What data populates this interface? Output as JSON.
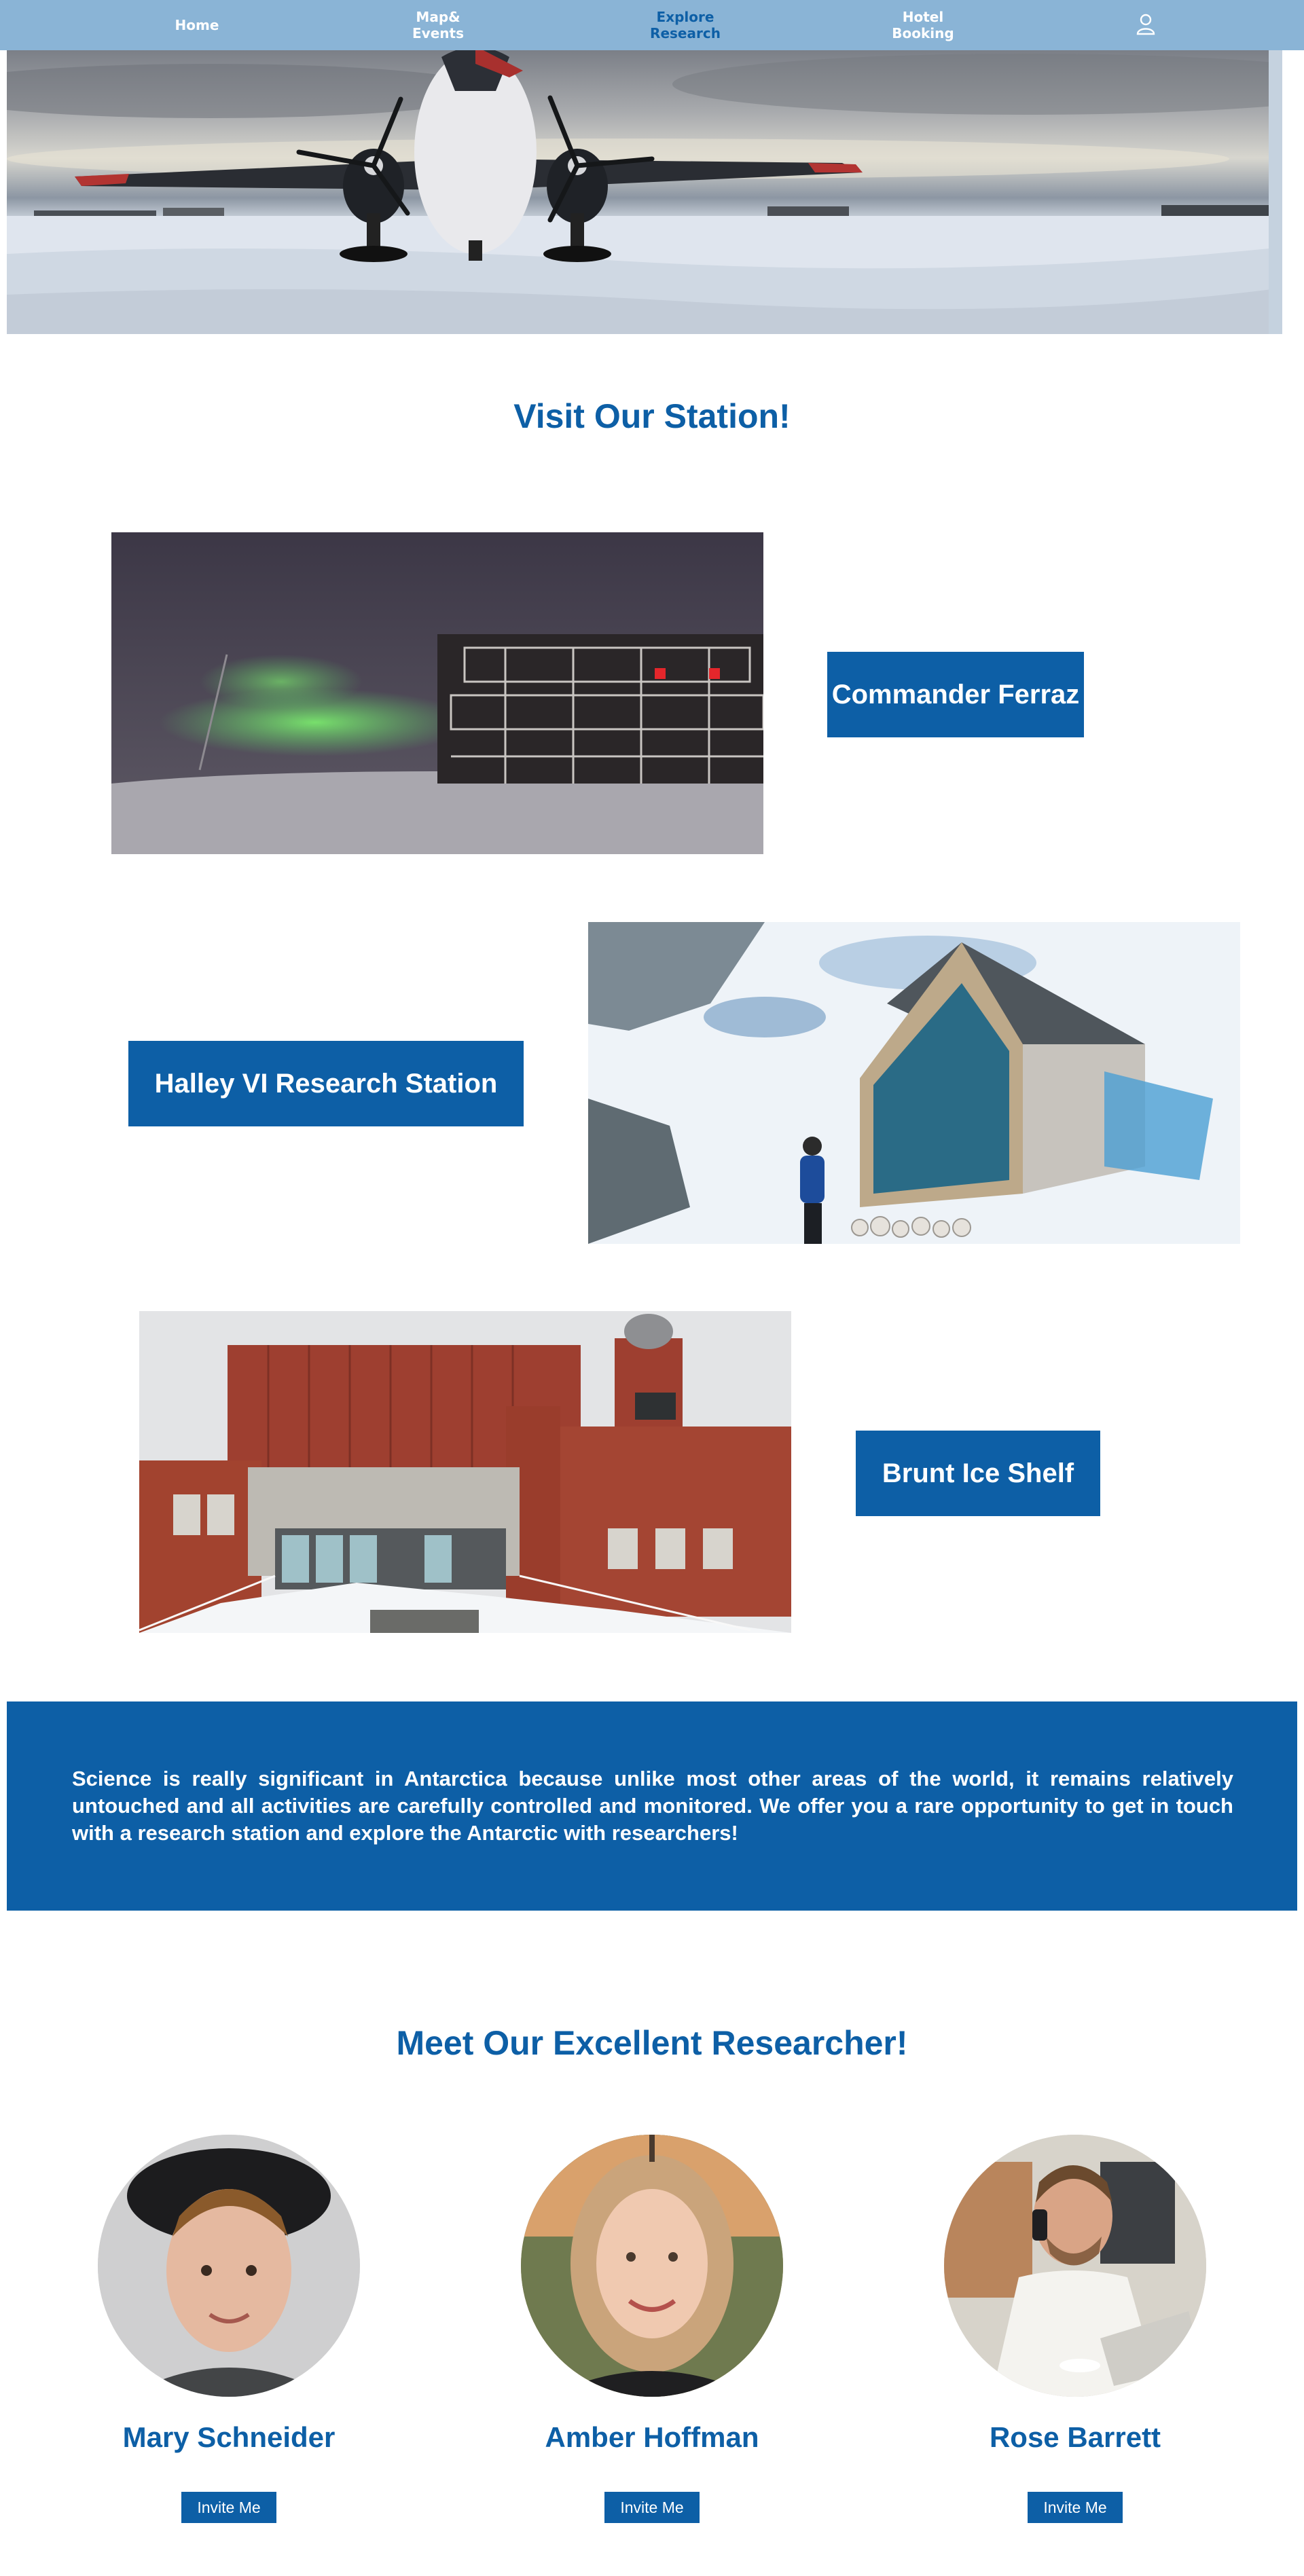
{
  "nav": {
    "items": [
      {
        "label": "Home"
      },
      {
        "label": "Map&\nEvents"
      },
      {
        "label": "Explore\nResearch"
      },
      {
        "label": "Hotel\nBooking"
      }
    ],
    "active_index": 2,
    "user_icon": "user-icon"
  },
  "stations": {
    "title": "Visit Our Station!",
    "items": [
      {
        "label": "Commander Ferraz"
      },
      {
        "label": "Halley VI Research Station"
      },
      {
        "label": "Brunt Ice Shelf"
      }
    ]
  },
  "info": {
    "text": "Science is really significant in Antarctica because unlike most other areas of the world, it remains relatively untouched and all activities are carefully controlled and monitored. We offer you a rare opportunity to get in touch with a research station and explore the Antarctic with researchers!"
  },
  "researchers": {
    "title": "Meet Our Excellent Researcher!",
    "invite_label": "Invite Me",
    "people": [
      {
        "name": "Mary Schneider"
      },
      {
        "name": "Amber Hoffman"
      },
      {
        "name": "Rose Barrett"
      }
    ]
  },
  "colors": {
    "nav_bg": "#8ab4d6",
    "accent": "#0d5fa6",
    "nav_active_text": "#0d5fa6"
  }
}
